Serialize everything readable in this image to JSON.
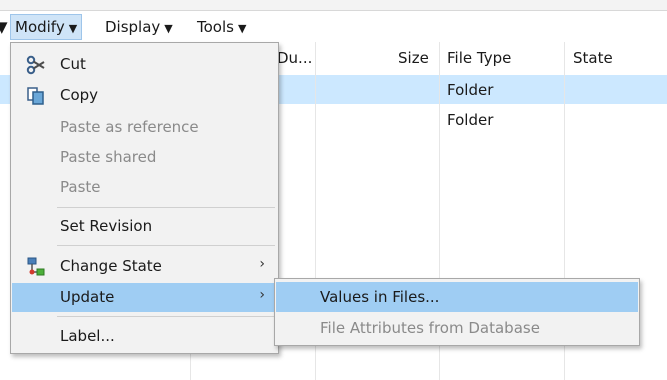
{
  "menubar": {
    "leading_caret": "▼",
    "items": [
      {
        "label": "Modify",
        "caret": "▼"
      },
      {
        "label": "Display",
        "caret": "▼"
      },
      {
        "label": "Tools",
        "caret": "▼"
      }
    ]
  },
  "grid": {
    "columns": [
      "Du...",
      "Size",
      "File Type",
      "State"
    ],
    "rows": [
      {
        "file_type": "Folder",
        "selected": true
      },
      {
        "file_type": "Folder",
        "selected": false
      }
    ]
  },
  "context_menu": {
    "items": [
      {
        "label": "Cut",
        "icon": "scissors-icon"
      },
      {
        "label": "Copy",
        "icon": "copy-icon"
      },
      {
        "label": "Paste as reference",
        "disabled": true
      },
      {
        "label": "Paste shared",
        "disabled": true
      },
      {
        "label": "Paste",
        "disabled": true
      },
      {
        "label": "Set Revision"
      },
      {
        "label": "Change State",
        "icon": "workflow-icon",
        "submenu_arrow": "›"
      },
      {
        "label": "Update",
        "submenu_arrow": "›",
        "highlighted": true
      },
      {
        "label": "Label..."
      }
    ]
  },
  "submenu": {
    "items": [
      {
        "label": "Values in Files...",
        "highlighted": true
      },
      {
        "label": "File Attributes from Database",
        "disabled": true
      }
    ]
  },
  "colors": {
    "highlight": "#9fcdf3",
    "selected_row": "#cce8ff",
    "menu_bg": "#f2f2f2",
    "disabled_text": "#8a8a8a"
  }
}
